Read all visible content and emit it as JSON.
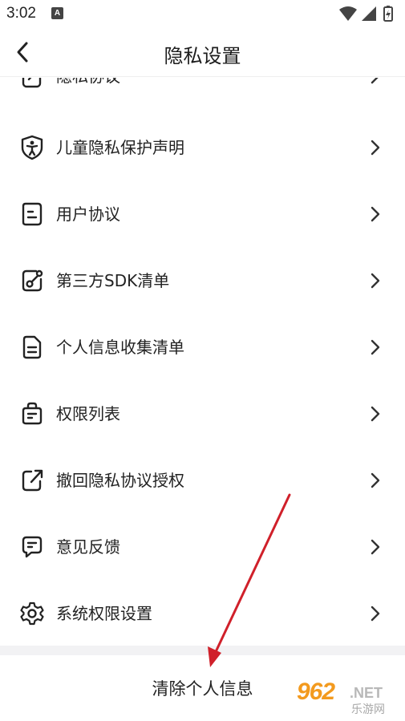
{
  "status_bar": {
    "time": "3:02",
    "notification_badge": "A",
    "icons": [
      "wifi-icon",
      "signal-icon",
      "battery-icon"
    ]
  },
  "app_bar": {
    "title": "隐私设置",
    "back_icon": "chevron-left-icon"
  },
  "menu": {
    "items": [
      {
        "label": "隐私协议",
        "icon": "edit-doc-icon"
      },
      {
        "label": "儿童隐私保护声明",
        "icon": "child-shield-icon"
      },
      {
        "label": "用户协议",
        "icon": "document-icon"
      },
      {
        "label": "第三方SDK清单",
        "icon": "link-square-icon"
      },
      {
        "label": "个人信息收集清单",
        "icon": "file-list-icon"
      },
      {
        "label": "权限列表",
        "icon": "bag-icon"
      },
      {
        "label": "撤回隐私协议授权",
        "icon": "share-out-icon"
      },
      {
        "label": "意见反馈",
        "icon": "feedback-icon"
      },
      {
        "label": "系统权限设置",
        "icon": "gear-icon"
      }
    ]
  },
  "clear_button": {
    "label": "清除个人信息"
  },
  "watermark": {
    "number": "962",
    "suffix": ".NET",
    "site_name": "乐游网"
  },
  "colors": {
    "annotation_arrow": "#d0202a",
    "watermark_orange": "#f39a1e",
    "separator": "#f2f2f4"
  }
}
